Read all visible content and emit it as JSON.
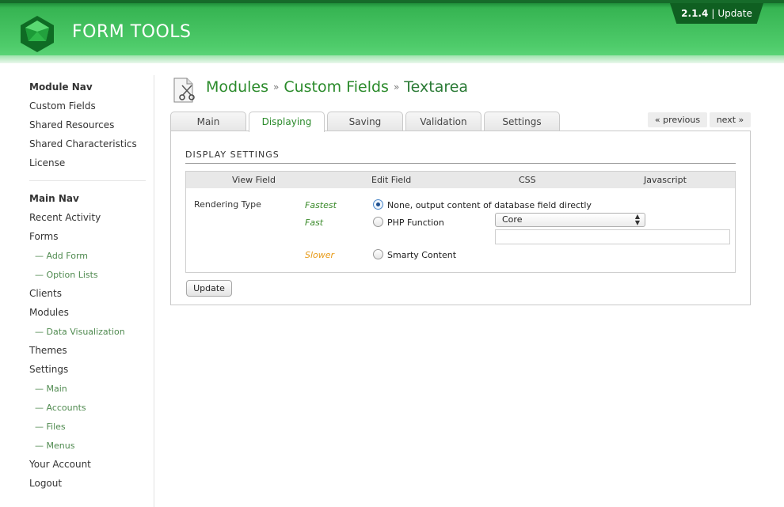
{
  "header": {
    "logo_text": "FORM TOOLS",
    "version": "2.1.4",
    "separator": "|",
    "update_link": "Update",
    "colors": {
      "header_green": "#3fc05c",
      "dark_green": "#0f5f21"
    }
  },
  "sidebar": {
    "module_nav_heading": "Module Nav",
    "module_nav": [
      "Custom Fields",
      "Shared Resources",
      "Shared Characteristics",
      "License"
    ],
    "main_nav_heading": "Main Nav",
    "main_nav": {
      "recent_activity": "Recent Activity",
      "forms": "Forms",
      "add_form": "— Add Form",
      "option_lists": "— Option Lists",
      "clients": "Clients",
      "modules": "Modules",
      "data_visualization": "— Data Visualization",
      "themes": "Themes",
      "settings": "Settings",
      "settings_main": "— Main",
      "settings_accounts": "— Accounts",
      "settings_files": "— Files",
      "settings_menus": "— Menus",
      "your_account": "Your Account",
      "logout": "Logout"
    }
  },
  "breadcrumb": {
    "modules": "Modules",
    "custom_fields": "Custom Fields",
    "current": "Textarea",
    "separator": "»"
  },
  "tabs": [
    "Main",
    "Displaying",
    "Saving",
    "Validation",
    "Settings"
  ],
  "active_tab": "Displaying",
  "pager": {
    "previous": "« previous",
    "next": "next »"
  },
  "display_settings": {
    "title": "DISPLAY SETTINGS",
    "columns": [
      "View Field",
      "Edit Field",
      "CSS",
      "Javascript"
    ],
    "rendering_type_label": "Rendering Type",
    "options": [
      {
        "speed": "Fastest",
        "label": "None, output content of database field directly",
        "checked": true
      },
      {
        "speed": "Fast",
        "label": "PHP Function",
        "checked": false
      },
      {
        "speed": "Slower",
        "label": "Smarty Content",
        "checked": false
      }
    ],
    "php_function_select": "Core",
    "php_function_input": "",
    "update_button": "Update"
  }
}
